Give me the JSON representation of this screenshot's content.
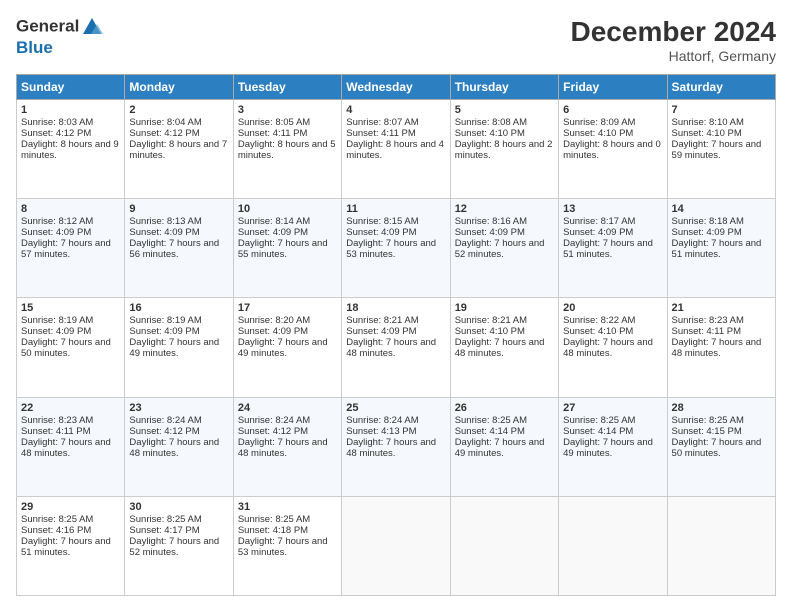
{
  "logo": {
    "line1": "General",
    "line2": "Blue"
  },
  "header": {
    "month_year": "December 2024",
    "location": "Hattorf, Germany"
  },
  "days_of_week": [
    "Sunday",
    "Monday",
    "Tuesday",
    "Wednesday",
    "Thursday",
    "Friday",
    "Saturday"
  ],
  "weeks": [
    [
      {
        "day": 1,
        "sunrise": "Sunrise: 8:03 AM",
        "sunset": "Sunset: 4:12 PM",
        "daylight": "Daylight: 8 hours and 9 minutes."
      },
      {
        "day": 2,
        "sunrise": "Sunrise: 8:04 AM",
        "sunset": "Sunset: 4:12 PM",
        "daylight": "Daylight: 8 hours and 7 minutes."
      },
      {
        "day": 3,
        "sunrise": "Sunrise: 8:05 AM",
        "sunset": "Sunset: 4:11 PM",
        "daylight": "Daylight: 8 hours and 5 minutes."
      },
      {
        "day": 4,
        "sunrise": "Sunrise: 8:07 AM",
        "sunset": "Sunset: 4:11 PM",
        "daylight": "Daylight: 8 hours and 4 minutes."
      },
      {
        "day": 5,
        "sunrise": "Sunrise: 8:08 AM",
        "sunset": "Sunset: 4:10 PM",
        "daylight": "Daylight: 8 hours and 2 minutes."
      },
      {
        "day": 6,
        "sunrise": "Sunrise: 8:09 AM",
        "sunset": "Sunset: 4:10 PM",
        "daylight": "Daylight: 8 hours and 0 minutes."
      },
      {
        "day": 7,
        "sunrise": "Sunrise: 8:10 AM",
        "sunset": "Sunset: 4:10 PM",
        "daylight": "Daylight: 7 hours and 59 minutes."
      }
    ],
    [
      {
        "day": 8,
        "sunrise": "Sunrise: 8:12 AM",
        "sunset": "Sunset: 4:09 PM",
        "daylight": "Daylight: 7 hours and 57 minutes."
      },
      {
        "day": 9,
        "sunrise": "Sunrise: 8:13 AM",
        "sunset": "Sunset: 4:09 PM",
        "daylight": "Daylight: 7 hours and 56 minutes."
      },
      {
        "day": 10,
        "sunrise": "Sunrise: 8:14 AM",
        "sunset": "Sunset: 4:09 PM",
        "daylight": "Daylight: 7 hours and 55 minutes."
      },
      {
        "day": 11,
        "sunrise": "Sunrise: 8:15 AM",
        "sunset": "Sunset: 4:09 PM",
        "daylight": "Daylight: 7 hours and 53 minutes."
      },
      {
        "day": 12,
        "sunrise": "Sunrise: 8:16 AM",
        "sunset": "Sunset: 4:09 PM",
        "daylight": "Daylight: 7 hours and 52 minutes."
      },
      {
        "day": 13,
        "sunrise": "Sunrise: 8:17 AM",
        "sunset": "Sunset: 4:09 PM",
        "daylight": "Daylight: 7 hours and 51 minutes."
      },
      {
        "day": 14,
        "sunrise": "Sunrise: 8:18 AM",
        "sunset": "Sunset: 4:09 PM",
        "daylight": "Daylight: 7 hours and 51 minutes."
      }
    ],
    [
      {
        "day": 15,
        "sunrise": "Sunrise: 8:19 AM",
        "sunset": "Sunset: 4:09 PM",
        "daylight": "Daylight: 7 hours and 50 minutes."
      },
      {
        "day": 16,
        "sunrise": "Sunrise: 8:19 AM",
        "sunset": "Sunset: 4:09 PM",
        "daylight": "Daylight: 7 hours and 49 minutes."
      },
      {
        "day": 17,
        "sunrise": "Sunrise: 8:20 AM",
        "sunset": "Sunset: 4:09 PM",
        "daylight": "Daylight: 7 hours and 49 minutes."
      },
      {
        "day": 18,
        "sunrise": "Sunrise: 8:21 AM",
        "sunset": "Sunset: 4:09 PM",
        "daylight": "Daylight: 7 hours and 48 minutes."
      },
      {
        "day": 19,
        "sunrise": "Sunrise: 8:21 AM",
        "sunset": "Sunset: 4:10 PM",
        "daylight": "Daylight: 7 hours and 48 minutes."
      },
      {
        "day": 20,
        "sunrise": "Sunrise: 8:22 AM",
        "sunset": "Sunset: 4:10 PM",
        "daylight": "Daylight: 7 hours and 48 minutes."
      },
      {
        "day": 21,
        "sunrise": "Sunrise: 8:23 AM",
        "sunset": "Sunset: 4:11 PM",
        "daylight": "Daylight: 7 hours and 48 minutes."
      }
    ],
    [
      {
        "day": 22,
        "sunrise": "Sunrise: 8:23 AM",
        "sunset": "Sunset: 4:11 PM",
        "daylight": "Daylight: 7 hours and 48 minutes."
      },
      {
        "day": 23,
        "sunrise": "Sunrise: 8:24 AM",
        "sunset": "Sunset: 4:12 PM",
        "daylight": "Daylight: 7 hours and 48 minutes."
      },
      {
        "day": 24,
        "sunrise": "Sunrise: 8:24 AM",
        "sunset": "Sunset: 4:12 PM",
        "daylight": "Daylight: 7 hours and 48 minutes."
      },
      {
        "day": 25,
        "sunrise": "Sunrise: 8:24 AM",
        "sunset": "Sunset: 4:13 PM",
        "daylight": "Daylight: 7 hours and 48 minutes."
      },
      {
        "day": 26,
        "sunrise": "Sunrise: 8:25 AM",
        "sunset": "Sunset: 4:14 PM",
        "daylight": "Daylight: 7 hours and 49 minutes."
      },
      {
        "day": 27,
        "sunrise": "Sunrise: 8:25 AM",
        "sunset": "Sunset: 4:14 PM",
        "daylight": "Daylight: 7 hours and 49 minutes."
      },
      {
        "day": 28,
        "sunrise": "Sunrise: 8:25 AM",
        "sunset": "Sunset: 4:15 PM",
        "daylight": "Daylight: 7 hours and 50 minutes."
      }
    ],
    [
      {
        "day": 29,
        "sunrise": "Sunrise: 8:25 AM",
        "sunset": "Sunset: 4:16 PM",
        "daylight": "Daylight: 7 hours and 51 minutes."
      },
      {
        "day": 30,
        "sunrise": "Sunrise: 8:25 AM",
        "sunset": "Sunset: 4:17 PM",
        "daylight": "Daylight: 7 hours and 52 minutes."
      },
      {
        "day": 31,
        "sunrise": "Sunrise: 8:25 AM",
        "sunset": "Sunset: 4:18 PM",
        "daylight": "Daylight: 7 hours and 53 minutes."
      },
      null,
      null,
      null,
      null
    ]
  ]
}
